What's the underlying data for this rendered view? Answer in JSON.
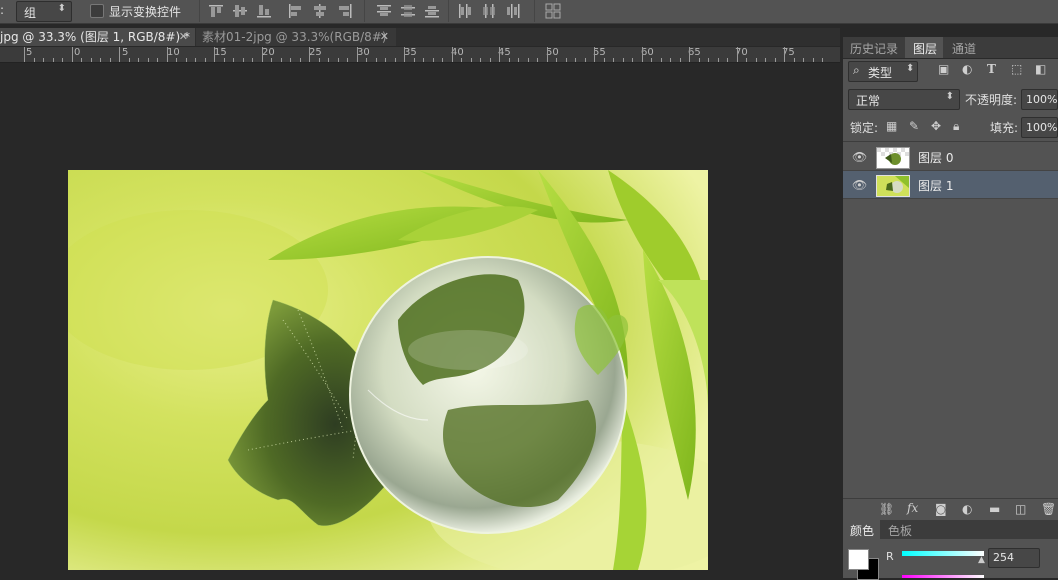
{
  "options_bar": {
    "leading_colon": ":",
    "auto_select_value": "组",
    "show_transform_label": "显示变换控件"
  },
  "tabs": [
    {
      "label": "jpg @ 33.3% (图层 1, RGB/8#) *",
      "active": true
    },
    {
      "label": "素材01-2jpg @ 33.3%(RGB/8#)",
      "active": false
    }
  ],
  "ruler": {
    "labels": [
      "5",
      "0",
      "5",
      "10",
      "15",
      "20",
      "25",
      "30",
      "35",
      "40",
      "45",
      "50",
      "55",
      "60",
      "65",
      "70",
      "75"
    ]
  },
  "panel_tabs": {
    "history": "历史记录",
    "layers": "图层",
    "channels": "通道"
  },
  "layers_panel": {
    "filter_kind": "类型",
    "blend_mode": "正常",
    "opacity_label": "不透明度:",
    "opacity_value": "100%",
    "lock_label": "锁定:",
    "fill_label": "填充:",
    "fill_value": "100%",
    "layers": [
      {
        "name": "图层 0",
        "visible": true,
        "selected": false
      },
      {
        "name": "图层 1",
        "visible": true,
        "selected": true
      }
    ]
  },
  "color_panel": {
    "tab_color": "颜色",
    "tab_swatches": "色板",
    "r_label": "R",
    "r_value": "254"
  },
  "colors": {
    "app_bg": "#282828",
    "panel_bg": "#535353",
    "selected_layer": "#54606f"
  }
}
